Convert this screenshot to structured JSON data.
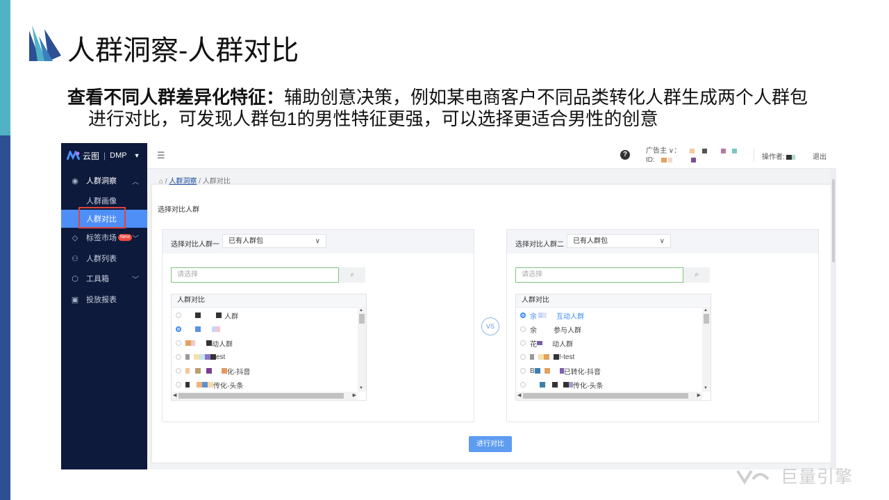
{
  "slide": {
    "title": "人群洞察-人群对比",
    "bullet_bold": "查看不同人群差异化特征：",
    "bullet_rest": "辅助创意决策，例如某电商客户不同品类转化人群生成两个人群包",
    "bullet_line2": "进行对比，可发现人群包1的男性特征更强，可以选择更适合男性的创意",
    "footer_brand": "巨量引擎",
    "colors": {
      "teal": "#4fb3c5",
      "navy": "#2d4f93",
      "accent": "#4e8ef7",
      "highlight": "#e0453e"
    }
  },
  "app": {
    "brand": "云图",
    "product": "DMP",
    "sidebar": {
      "group_label": "人群洞察",
      "sub_items": [
        "人群画像",
        "人群对比"
      ],
      "items": [
        {
          "label": "标签市场",
          "badge": "New",
          "icon": "tag-icon"
        },
        {
          "label": "人群列表",
          "icon": "people-icon"
        },
        {
          "label": "工具箱",
          "icon": "toolbox-icon"
        },
        {
          "label": "投放报表",
          "icon": "chart-icon"
        }
      ]
    },
    "topbar": {
      "advertiser_label": "广告主 ∨：",
      "id_label": "ID:",
      "operator_label": "操作者:",
      "exit_label": "退出",
      "help": "?"
    },
    "breadcrumb": {
      "level1": "人群洞察",
      "sep": "/",
      "level2": "人群对比"
    },
    "panel_title": "选择对比人群",
    "groups": [
      {
        "label": "选择对比人群一",
        "select_value": "已有人群包",
        "search_placeholder": "请选择",
        "list_header": "人群对比",
        "rows": [
          "人群",
          "",
          "动人群",
          "est",
          "化-抖音",
          "传化-头条"
        ],
        "selected_index": 1
      },
      {
        "label": "选择对比人群二",
        "select_value": "已有人群包",
        "search_placeholder": "请选择",
        "list_header": "人群对比",
        "rows": [
          "互动人群",
          "参与人群",
          "动人群",
          "!-test",
          "已转化-抖音",
          "传化-头条"
        ],
        "row_prefix": [
          "余",
          "余",
          "花",
          "",
          "B",
          ""
        ],
        "selected_index": 0
      }
    ],
    "vs_label": "VS",
    "submit_label": "进行对比"
  }
}
